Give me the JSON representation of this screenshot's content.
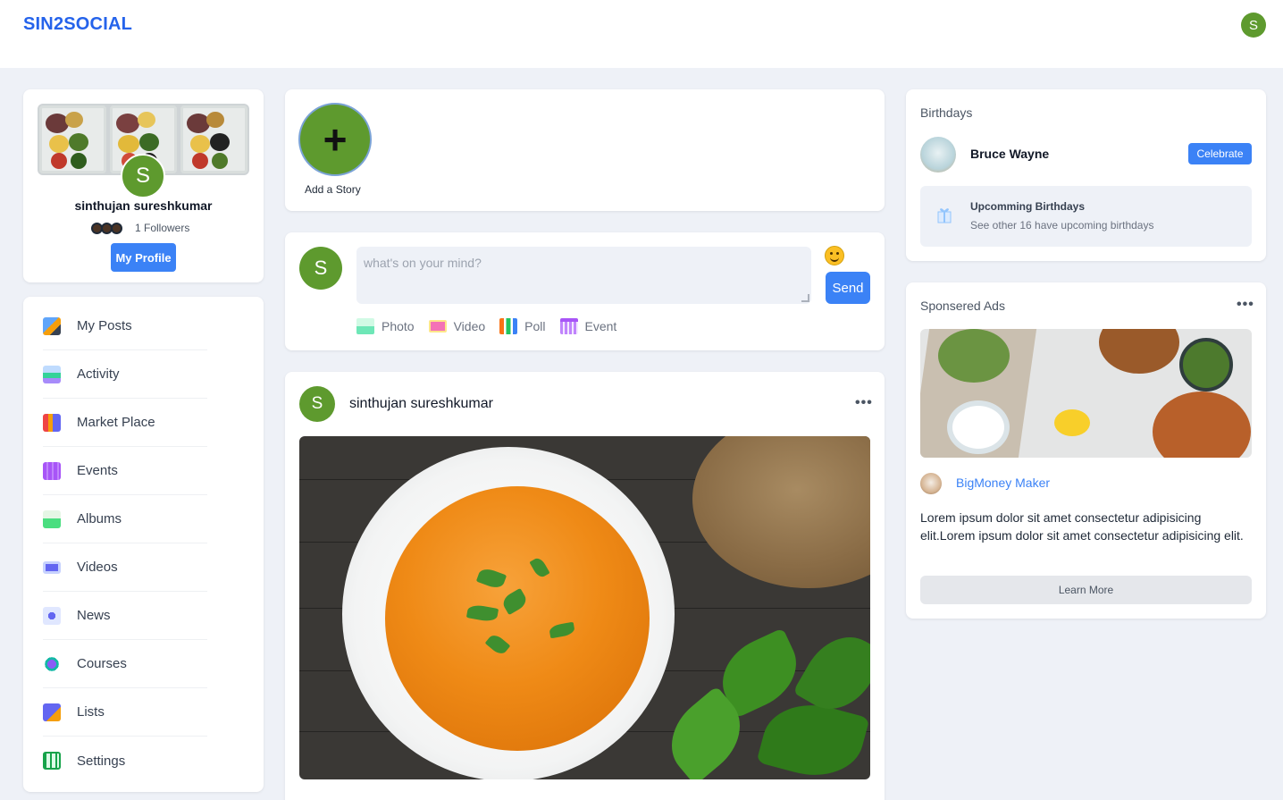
{
  "header": {
    "brand": "SIN2SOCIAL",
    "avatar_initial": "S"
  },
  "profile": {
    "avatar_initial": "S",
    "name": "sinthujan sureshkumar",
    "followers": "1 Followers",
    "button": "My Profile"
  },
  "nav": {
    "items": [
      {
        "label": "My Posts",
        "icon": "my-posts-icon"
      },
      {
        "label": "Activity",
        "icon": "activity-icon"
      },
      {
        "label": "Market Place",
        "icon": "market-place-icon"
      },
      {
        "label": "Events",
        "icon": "events-icon"
      },
      {
        "label": "Albums",
        "icon": "albums-icon"
      },
      {
        "label": "Videos",
        "icon": "videos-icon"
      },
      {
        "label": "News",
        "icon": "news-icon"
      },
      {
        "label": "Courses",
        "icon": "courses-icon"
      },
      {
        "label": "Lists",
        "icon": "lists-icon"
      },
      {
        "label": "Settings",
        "icon": "settings-icon"
      }
    ]
  },
  "story": {
    "add_label": "Add a Story",
    "plus": "+"
  },
  "composer": {
    "avatar_initial": "S",
    "placeholder": "what's on your mind?",
    "send": "Send",
    "attachments": [
      {
        "label": "Photo",
        "icon": "photo-icon"
      },
      {
        "label": "Video",
        "icon": "video-icon"
      },
      {
        "label": "Poll",
        "icon": "poll-icon"
      },
      {
        "label": "Event",
        "icon": "event-icon"
      }
    ]
  },
  "post": {
    "avatar_initial": "S",
    "author": "sinthujan sureshkumar",
    "menu": "•••"
  },
  "birthdays": {
    "title": "Birthdays",
    "person": "Bruce Wayne",
    "celebrate": "Celebrate",
    "upcoming_title": "Upcomming Birthdays",
    "upcoming_sub": "See other 16 have upcoming birthdays"
  },
  "ads": {
    "title": "Sponsered Ads",
    "menu": "•••",
    "advertiser": "BigMoney Maker",
    "text": "Lorem ipsum dolor sit amet consectetur adipisicing elit.Lorem ipsum dolor sit amet consectetur adipisicing elit.",
    "button": "Learn More"
  },
  "colors": {
    "brand": "#2563eb",
    "primary_button": "#3b82f6",
    "avatar": "#5e9a2e",
    "background": "#eef1f7"
  }
}
